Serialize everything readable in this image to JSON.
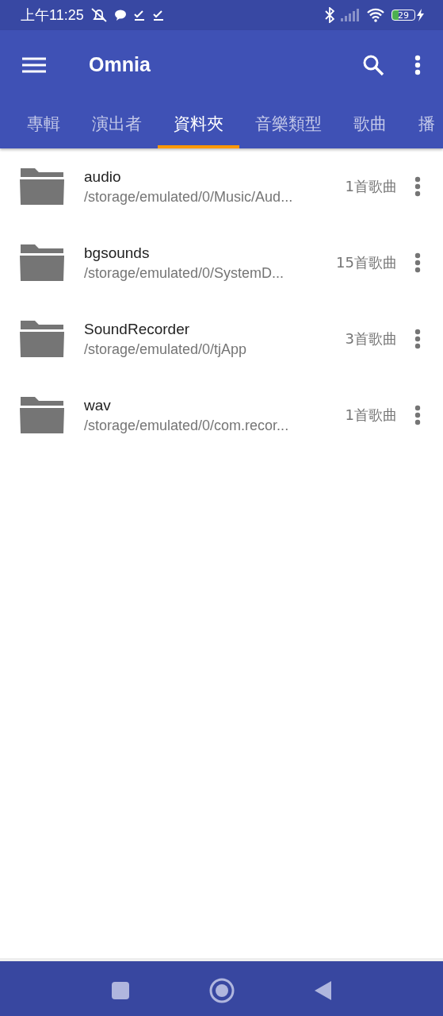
{
  "status_bar": {
    "time": "上午11:25",
    "battery": "29"
  },
  "app_bar": {
    "title": "Omnia"
  },
  "tabs": [
    {
      "label": "專輯",
      "selected": false
    },
    {
      "label": "演出者",
      "selected": false
    },
    {
      "label": "資料夾",
      "selected": true
    },
    {
      "label": "音樂類型",
      "selected": false
    },
    {
      "label": "歌曲",
      "selected": false
    },
    {
      "label": "播",
      "selected": false
    }
  ],
  "folders": [
    {
      "name": "audio",
      "path": "/storage/emulated/0/Music/Aud...",
      "count": "1首歌曲"
    },
    {
      "name": "bgsounds",
      "path": "/storage/emulated/0/SystemD...",
      "count": "15首歌曲"
    },
    {
      "name": "SoundRecorder",
      "path": "/storage/emulated/0/tjApp",
      "count": "3首歌曲"
    },
    {
      "name": "wav",
      "path": "/storage/emulated/0/com.recor...",
      "count": "1首歌曲"
    }
  ]
}
